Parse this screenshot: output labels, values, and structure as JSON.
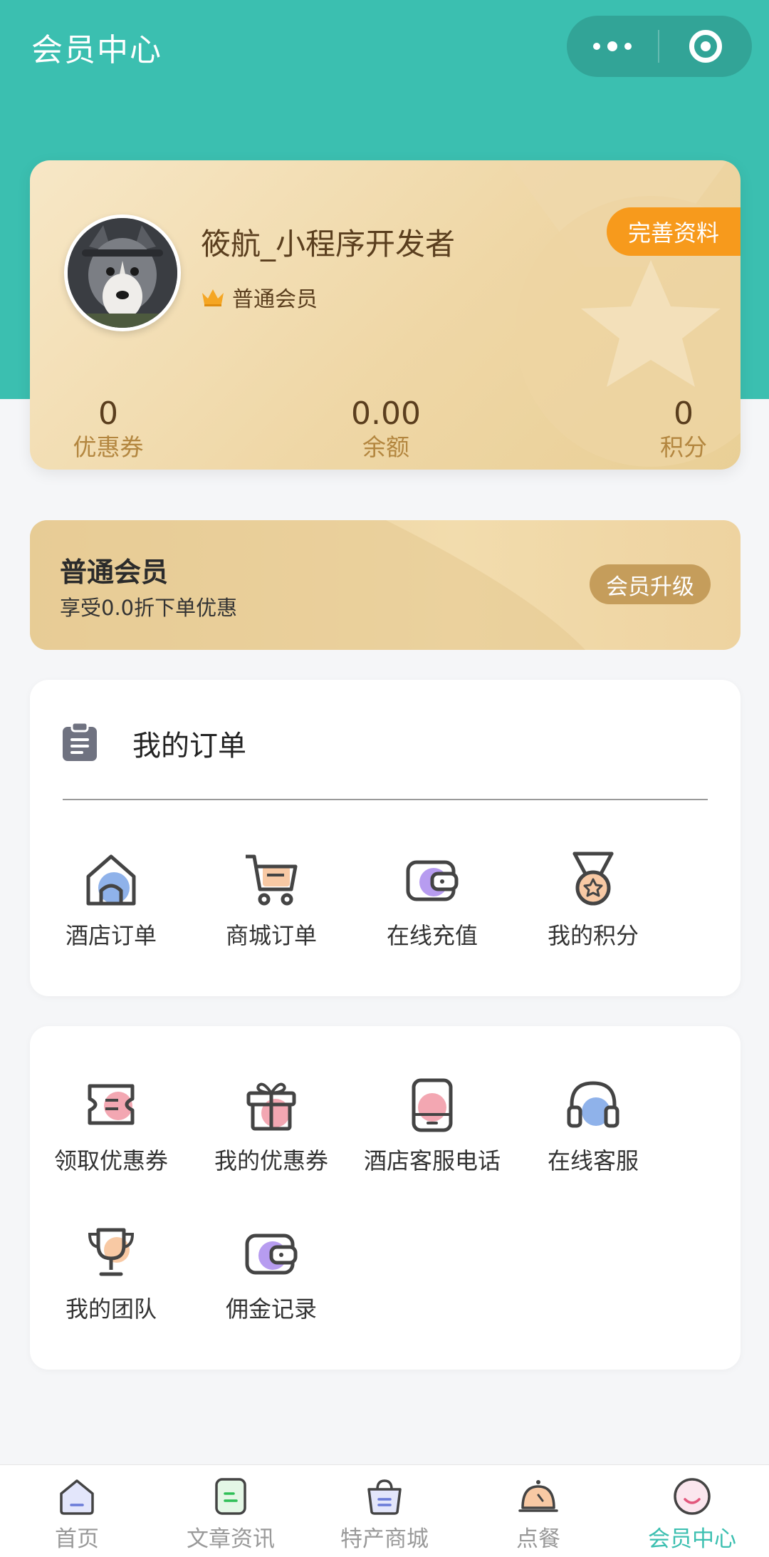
{
  "header": {
    "title": "会员中心"
  },
  "profile": {
    "username": "筱航_小程序开发者",
    "level": "普通会员",
    "complete_label": "完善资料",
    "stats": [
      {
        "value": "0",
        "label": "优惠券"
      },
      {
        "value": "0.00",
        "label": "余额"
      },
      {
        "value": "0",
        "label": "积分"
      }
    ]
  },
  "membership": {
    "title": "普通会员",
    "subtitle": "享受0.0折下单优惠",
    "upgrade_label": "会员升级"
  },
  "orders": {
    "title": "我的订单",
    "items": [
      {
        "label": "酒店订单",
        "icon": "house-icon"
      },
      {
        "label": "商城订单",
        "icon": "cart-icon"
      },
      {
        "label": "在线充值",
        "icon": "wallet-icon"
      },
      {
        "label": "我的积分",
        "icon": "medal-icon"
      }
    ]
  },
  "services": {
    "items": [
      {
        "label": "领取优惠券",
        "icon": "ticket-icon"
      },
      {
        "label": "我的优惠券",
        "icon": "gift-icon"
      },
      {
        "label": "酒店客服电话",
        "icon": "phone-icon"
      },
      {
        "label": "在线客服",
        "icon": "headset-icon"
      },
      {
        "label": "我的团队",
        "icon": "trophy-icon"
      },
      {
        "label": "佣金记录",
        "icon": "wallet-icon"
      }
    ]
  },
  "tabbar": {
    "tabs": [
      {
        "label": "首页",
        "icon": "home-icon"
      },
      {
        "label": "文章资讯",
        "icon": "article-icon"
      },
      {
        "label": "特产商城",
        "icon": "shop-bag-icon"
      },
      {
        "label": "点餐",
        "icon": "dining-bell-icon"
      },
      {
        "label": "会员中心",
        "icon": "member-icon",
        "active": true
      }
    ]
  },
  "colors": {
    "primary": "#3bbfb0",
    "accent_orange": "#f79a1c",
    "gold": "#c59d5b",
    "card_brown_text": "#5a3e1e"
  }
}
